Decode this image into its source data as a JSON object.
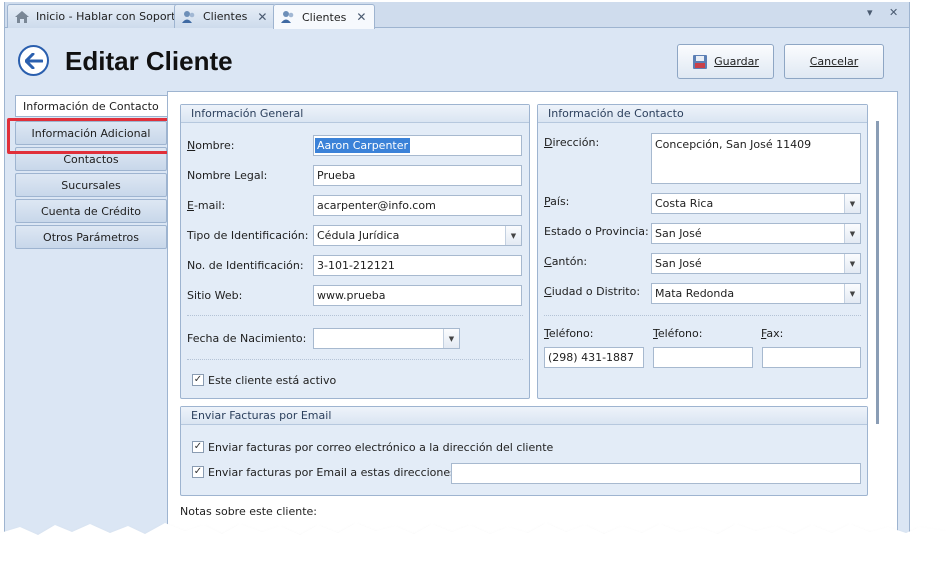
{
  "tabs": [
    {
      "label": "Inicio - Hablar con Soporte",
      "icon": "home-icon",
      "active": false
    },
    {
      "label": "Clientes",
      "icon": "clients-icon",
      "active": false
    },
    {
      "label": "Clientes",
      "icon": "clients-icon",
      "active": true
    }
  ],
  "window_controls": {
    "dropdown": "▾",
    "close": "✕"
  },
  "header": {
    "title": "Editar Cliente",
    "save_label": "Guardar",
    "cancel_label": "Cancelar"
  },
  "nav": {
    "header": "Información de Contacto",
    "items": [
      "Información Adicional",
      "Contactos",
      "Sucursales",
      "Cuenta de Crédito",
      "Otros Parámetros"
    ],
    "highlight_color": "#e0303a"
  },
  "general": {
    "title": "Información General",
    "nombre_label": "Nombre:",
    "nombre_value": "Aaron Carpenter",
    "nombre_legal_label": "Nombre Legal:",
    "nombre_legal_value": "Prueba",
    "email_label": "E-mail:",
    "email_value": "acarpenter@info.com",
    "tipo_id_label": "Tipo de Identificación:",
    "tipo_id_value": "Cédula Jurídica",
    "no_id_label": "No. de Identificación:",
    "no_id_value": "3-101-212121",
    "web_label": "Sitio Web:",
    "web_value": "www.prueba",
    "fecha_label": "Fecha de Nacimiento:",
    "fecha_value": "",
    "activo_label": "Este cliente está activo",
    "activo_checked": true
  },
  "contacto": {
    "title": "Información de Contacto",
    "direccion_label": "Dirección:",
    "direccion_value": "Concepción, San José 11409",
    "pais_label": "País:",
    "pais_value": "Costa Rica",
    "estado_label": "Estado o Provincia:",
    "estado_value": "San José",
    "canton_label": "Cantón:",
    "canton_value": "San José",
    "ciudad_label": "Ciudad o Distrito:",
    "ciudad_value": "Mata Redonda",
    "telefono1_label": "Teléfono:",
    "telefono1_value": "(298) 431-1887",
    "telefono2_label": "Teléfono:",
    "telefono2_value": "",
    "fax_label": "Fax:",
    "fax_value": ""
  },
  "facturas": {
    "title": "Enviar Facturas por Email",
    "opt1_label": "Enviar facturas por correo electrónico a la dirección del cliente",
    "opt1_checked": true,
    "opt2_label": "Enviar facturas por Email a estas direcciones:",
    "opt2_checked": true,
    "opt2_value": ""
  },
  "notas_label": "Notas sobre este cliente:",
  "colors": {
    "accent": "#2a5fae",
    "selection": "#3b82d8",
    "panel": "#e3ecf7"
  }
}
